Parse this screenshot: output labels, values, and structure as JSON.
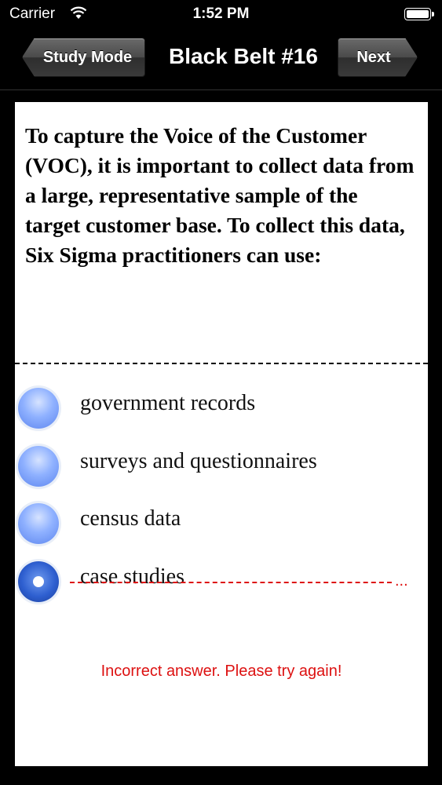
{
  "status": {
    "carrier": "Carrier",
    "time": "1:52 PM"
  },
  "nav": {
    "back_label": "Study Mode",
    "title": "Black Belt #16",
    "next_label": "Next"
  },
  "question": "To capture the Voice of the Customer (VOC), it is important to collect data from a large, representative sample of the target customer base. To collect this data, Six Sigma practitioners can use:",
  "options": [
    {
      "label": "government records",
      "selected": false
    },
    {
      "label": "surveys and questionnaires",
      "selected": false
    },
    {
      "label": "census data",
      "selected": false
    },
    {
      "label": "case studies",
      "selected": true,
      "struck_out": true
    }
  ],
  "feedback": "Incorrect answer. Please try again!",
  "colors": {
    "error": "#dd1111",
    "radio": "#8fb1ff",
    "radio_selected": "#2e5fd0"
  }
}
